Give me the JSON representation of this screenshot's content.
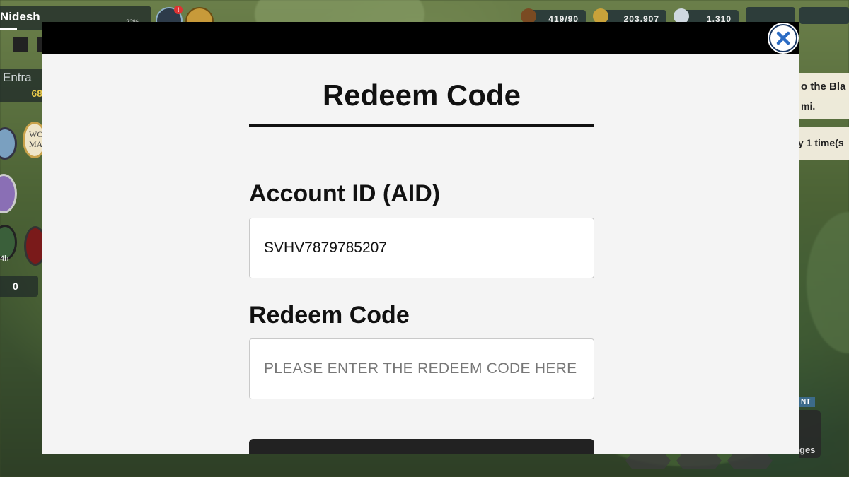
{
  "game_hud": {
    "player_name": "Nidesh",
    "xp_percent": "22%",
    "notification_badge": "!",
    "entrance_label": "Entra",
    "entrance_value": "68",
    "world_map_label": "WO MA",
    "timer_label": "4h",
    "counter_value": "0",
    "resources": [
      {
        "icon": "troops-icon",
        "value": "419/90"
      },
      {
        "icon": "gold-coin-icon",
        "value": "203,907"
      },
      {
        "icon": "gem-icon",
        "value": "1,310"
      }
    ],
    "quest_line1": "o the Bla",
    "quest_line2": "mi.",
    "quest_times": "y 1 time(s",
    "event_badge": "NT",
    "badges_label": "ges"
  },
  "modal": {
    "title": "Redeem Code",
    "account_id_label": "Account ID (AID)",
    "account_id_value": "SVHV7879785207",
    "redeem_code_label": "Redeem Code",
    "redeem_code_placeholder": "PLEASE ENTER THE REDEEM CODE HERE",
    "redeem_code_value": "",
    "close_icon": "close-icon",
    "colors": {
      "topbar": "#000000",
      "background": "#f4f4f4",
      "close_border": "#1b3a66",
      "submit_button": "#222222"
    }
  }
}
